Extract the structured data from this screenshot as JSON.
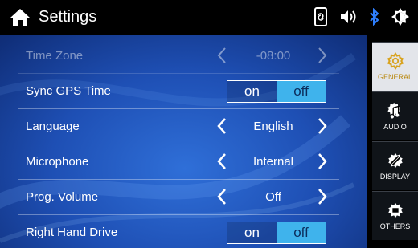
{
  "header": {
    "title": "Settings"
  },
  "status_icons": [
    "phone-sync-icon",
    "volume-icon",
    "bluetooth-icon",
    "brightness-icon"
  ],
  "settings": [
    {
      "label": "Time Zone",
      "control": "stepper",
      "value": "-08:00",
      "enabled": false
    },
    {
      "label": "Sync GPS Time",
      "control": "toggle",
      "on": "on",
      "off": "off",
      "selected": "off"
    },
    {
      "label": "Language",
      "control": "stepper",
      "value": "English",
      "enabled": true
    },
    {
      "label": "Microphone",
      "control": "stepper",
      "value": "Internal",
      "enabled": true
    },
    {
      "label": "Prog. Volume",
      "control": "stepper",
      "value": "Off",
      "enabled": true
    },
    {
      "label": "Right Hand Drive",
      "control": "toggle",
      "on": "on",
      "off": "off",
      "selected": "off"
    }
  ],
  "tabs": [
    {
      "label": "GENERAL",
      "icon": "gear-icon",
      "active": true
    },
    {
      "label": "AUDIO",
      "icon": "music-gear-icon",
      "active": false
    },
    {
      "label": "DISPLAY",
      "icon": "display-gear-icon",
      "active": false
    },
    {
      "label": "OTHERS",
      "icon": "others-gear-icon",
      "active": false
    }
  ],
  "colors": {
    "toggle_selected": "#3fb3ec",
    "active_tab_text": "#b8860b",
    "background": "#1e4fb4"
  }
}
